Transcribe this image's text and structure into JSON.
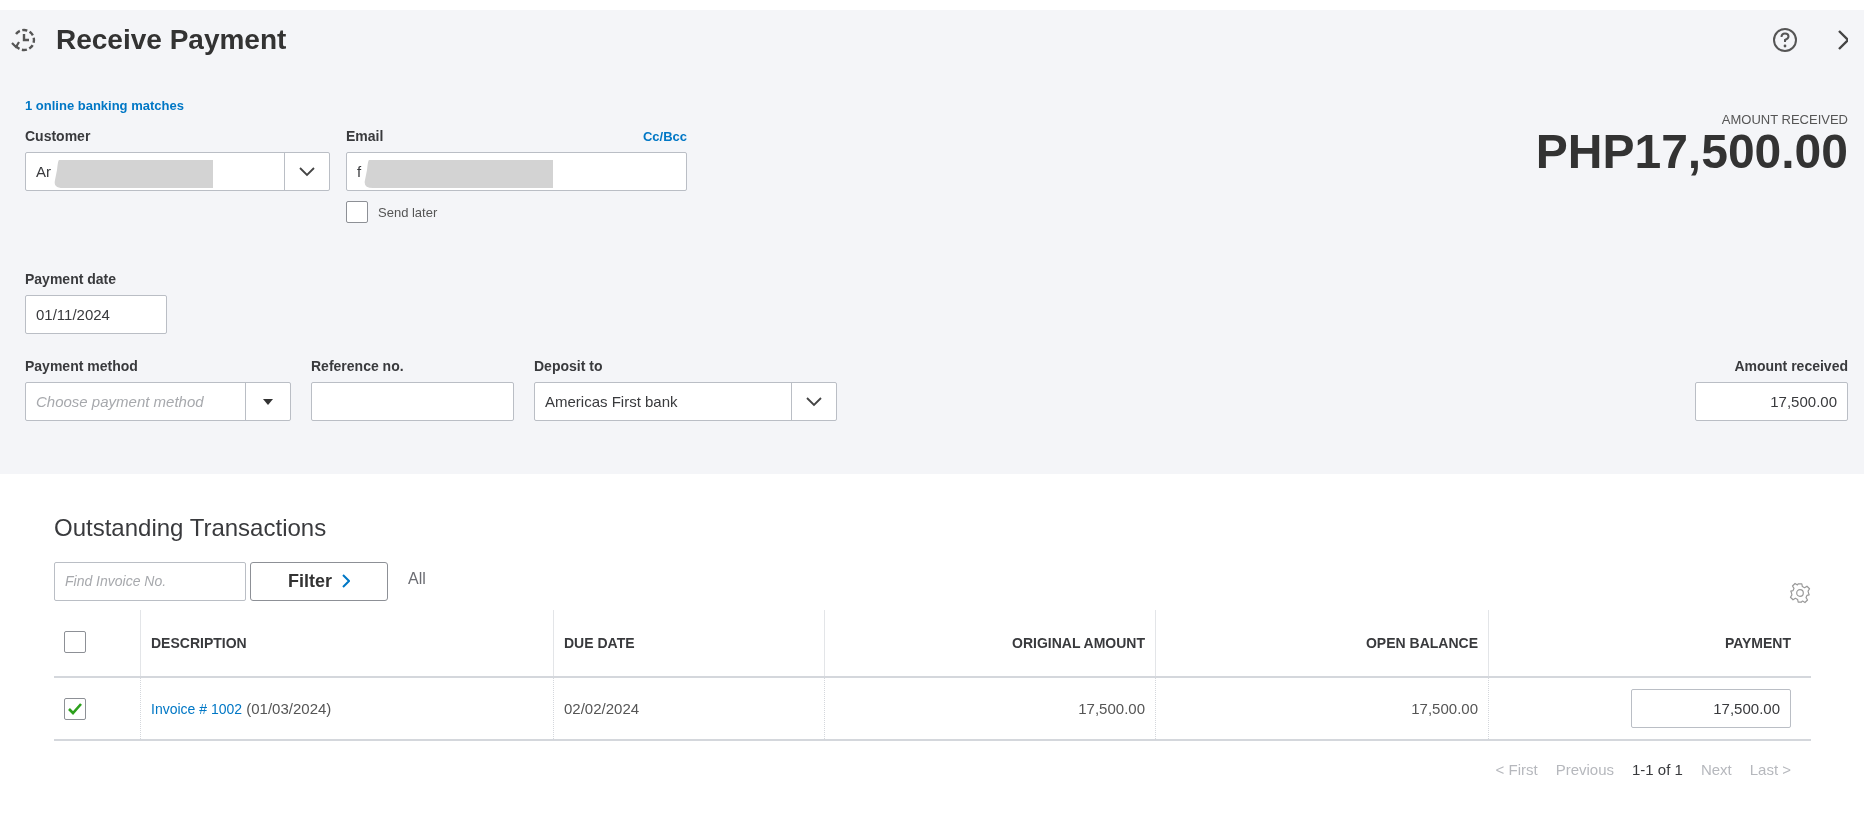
{
  "header": {
    "title": "Receive Payment"
  },
  "form": {
    "banking_link": "1 online banking matches",
    "customer": {
      "label": "Customer",
      "value": "Ar"
    },
    "email": {
      "label": "Email",
      "value": "f",
      "cc_link": "Cc/Bcc"
    },
    "send_later": {
      "label": "Send later",
      "checked": false
    },
    "amount_summary": {
      "label": "AMOUNT RECEIVED",
      "value": "PHP17,500.00"
    },
    "payment_date": {
      "label": "Payment date",
      "value": "01/11/2024"
    },
    "payment_method": {
      "label": "Payment method",
      "placeholder": "Choose payment method"
    },
    "reference": {
      "label": "Reference no."
    },
    "deposit_to": {
      "label": "Deposit to",
      "value": "Americas First bank"
    },
    "amount_received": {
      "label": "Amount received",
      "value": "17,500.00"
    }
  },
  "transactions": {
    "title": "Outstanding Transactions",
    "search": {
      "placeholder": "Find Invoice No."
    },
    "filter_button": "Filter",
    "filter_value": "All",
    "table": {
      "select_all_checked": false,
      "columns": [
        "DESCRIPTION",
        "DUE DATE",
        "ORIGINAL AMOUNT",
        "OPEN BALANCE",
        "PAYMENT"
      ],
      "rows": [
        {
          "checked": true,
          "invoice_link": "Invoice # 1002",
          "invoice_date": "(01/03/2024)",
          "due_date": "02/02/2024",
          "original_amount": "17,500.00",
          "open_balance": "17,500.00",
          "payment": "17,500.00"
        }
      ]
    },
    "pagination": [
      {
        "label": "< First",
        "disabled": true
      },
      {
        "label": "Previous",
        "disabled": true
      },
      {
        "label": "1-1 of 1",
        "disabled": false
      },
      {
        "label": "Next",
        "disabled": true
      },
      {
        "label": "Last >",
        "disabled": true
      }
    ]
  }
}
